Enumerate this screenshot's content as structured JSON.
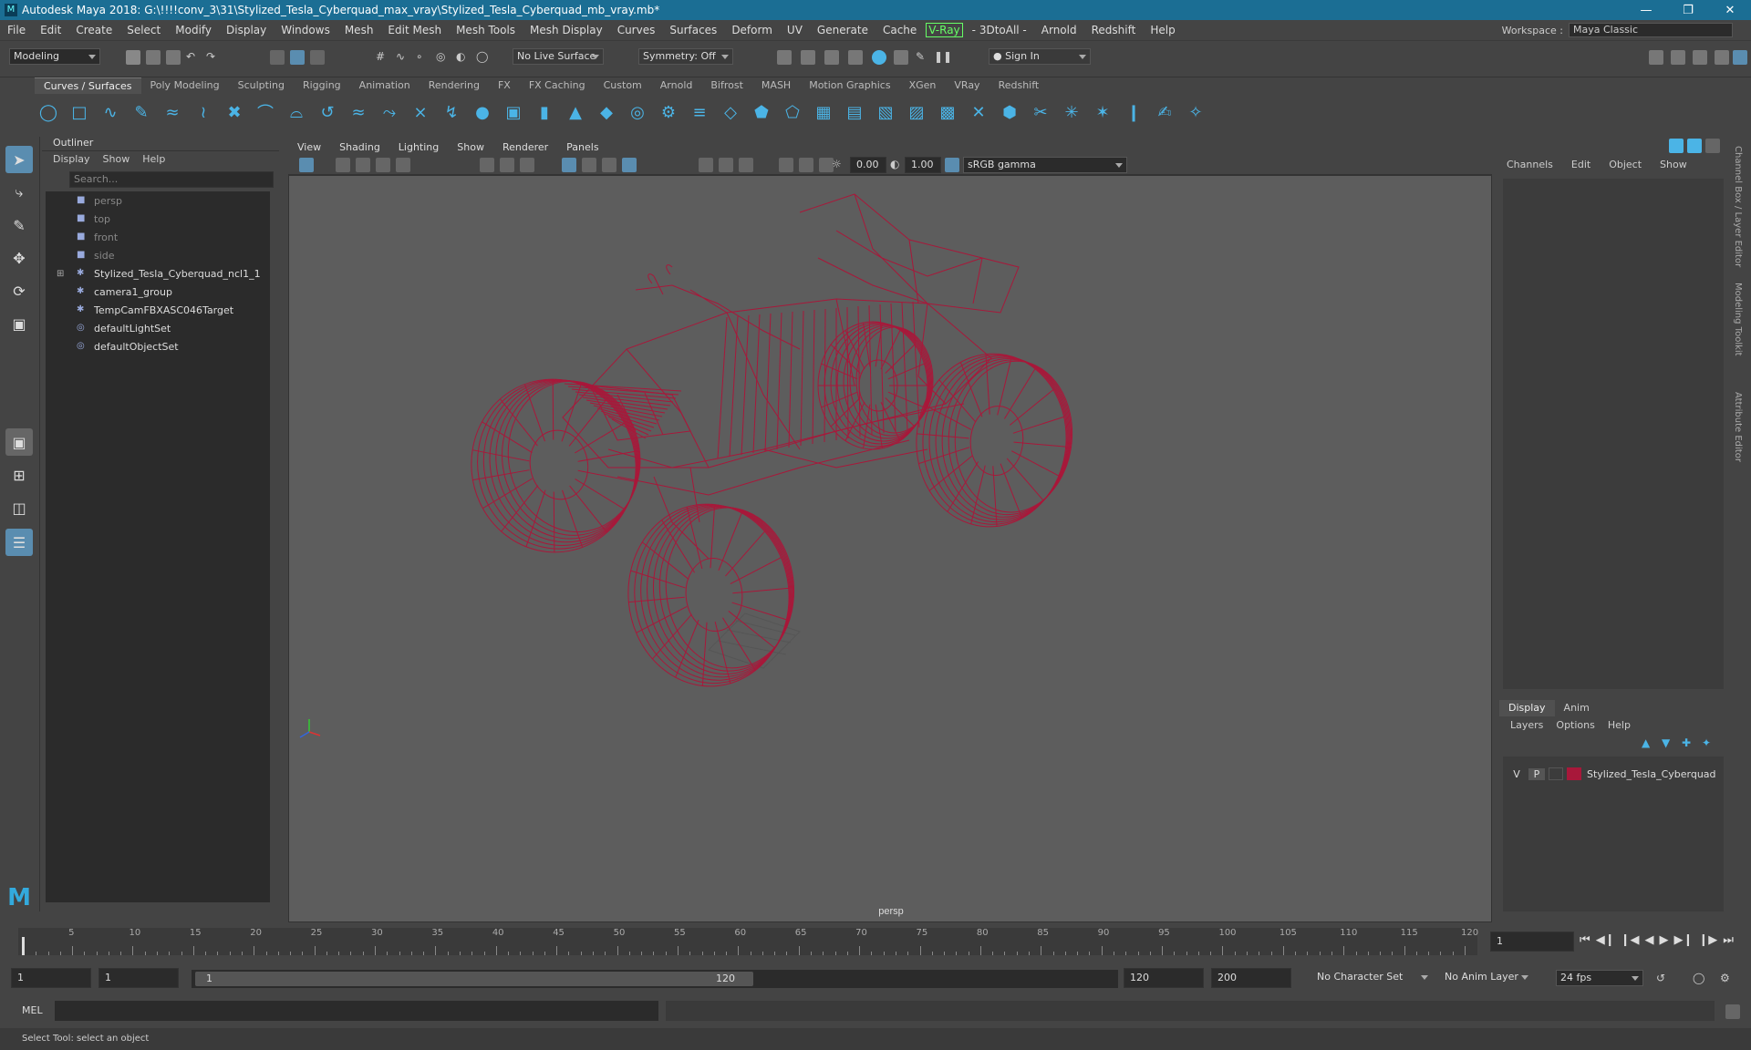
{
  "window": {
    "title": "Autodesk Maya 2018: G:\\!!!!conv_3\\31\\Stylized_Tesla_Cyberquad_max_vray\\Stylized_Tesla_Cyberquad_mb_vray.mb*"
  },
  "menu": [
    "File",
    "Edit",
    "Create",
    "Select",
    "Modify",
    "Display",
    "Windows",
    "Mesh",
    "Edit Mesh",
    "Mesh Tools",
    "Mesh Display",
    "Curves",
    "Surfaces",
    "Deform",
    "UV",
    "Generate",
    "Cache",
    "V-Ray",
    "- 3DtoAll -",
    "Arnold",
    "Redshift",
    "Help"
  ],
  "workspace": {
    "label": "Workspace :",
    "value": "Maya Classic"
  },
  "status": {
    "mode": "Modeling",
    "live_surface": "No Live Surface",
    "symmetry": "Symmetry: Off",
    "sign_in": "Sign In"
  },
  "shelf_tabs": [
    "Curves / Surfaces",
    "Poly Modeling",
    "Sculpting",
    "Rigging",
    "Animation",
    "Rendering",
    "FX",
    "FX Caching",
    "Custom",
    "Arnold",
    "Bifrost",
    "MASH",
    "Motion Graphics",
    "XGen",
    "VRay",
    "Redshift"
  ],
  "outliner": {
    "title": "Outliner",
    "menu": [
      "Display",
      "Show",
      "Help"
    ],
    "search_placeholder": "Search...",
    "items": [
      {
        "label": "persp",
        "icon": "camera-icon",
        "dim": true
      },
      {
        "label": "top",
        "icon": "camera-icon",
        "dim": true
      },
      {
        "label": "front",
        "icon": "camera-icon",
        "dim": true
      },
      {
        "label": "side",
        "icon": "camera-icon",
        "dim": true
      },
      {
        "label": "Stylized_Tesla_Cyberquad_ncl1_1",
        "icon": "group-icon",
        "dim": false
      },
      {
        "label": "camera1_group",
        "icon": "group-icon",
        "dim": false
      },
      {
        "label": "TempCamFBXASC046Target",
        "icon": "group-icon",
        "dim": false
      },
      {
        "label": "defaultLightSet",
        "icon": "set-icon",
        "dim": false
      },
      {
        "label": "defaultObjectSet",
        "icon": "set-icon",
        "dim": false
      }
    ]
  },
  "viewport": {
    "menu": [
      "View",
      "Shading",
      "Lighting",
      "Show",
      "Renderer",
      "Panels"
    ],
    "exposure": "0.00",
    "gamma": "1.00",
    "colorspace": "sRGB gamma",
    "camera_label": "persp",
    "wire_color": "#a8183a"
  },
  "channel_box": {
    "menu": [
      "Channels",
      "Edit",
      "Object",
      "Show"
    ]
  },
  "layer_editor": {
    "tabs": [
      "Display",
      "Anim"
    ],
    "menu": [
      "Layers",
      "Options",
      "Help"
    ],
    "layer": {
      "v": "V",
      "p": "P",
      "name": "Stylized_Tesla_Cyberquad",
      "color": "#a8183a"
    }
  },
  "side_tabs": [
    "Channel Box / Layer Editor",
    "Modeling Toolkit",
    "Attribute Editor"
  ],
  "timeline": {
    "ticks": [
      5,
      10,
      15,
      20,
      25,
      30,
      35,
      40,
      45,
      50,
      55,
      60,
      65,
      70,
      75,
      80,
      85,
      90,
      95,
      100,
      105,
      110,
      115,
      120
    ],
    "current": "1",
    "current_field": "1"
  },
  "range": {
    "start": "1",
    "start2": "1",
    "slider_start": "1",
    "slider_end": "120",
    "end": "120",
    "end2": "200",
    "char_set": "No Character Set",
    "anim_layer": "No Anim Layer",
    "fps": "24 fps"
  },
  "command": {
    "label": "MEL"
  },
  "help": "Select Tool: select an object"
}
